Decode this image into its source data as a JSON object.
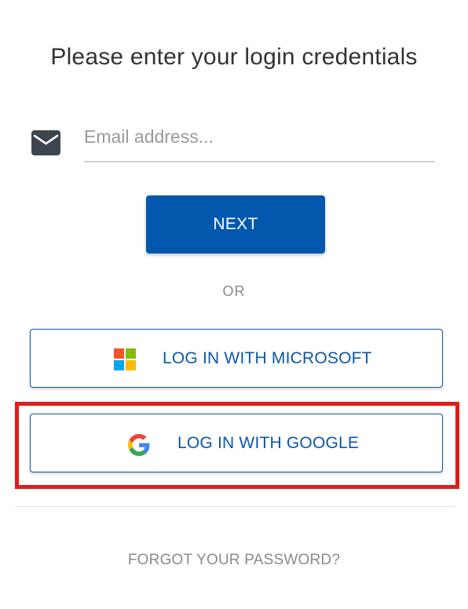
{
  "header": {
    "title": "Please enter your login credentials"
  },
  "email": {
    "value": "",
    "placeholder": "Email address...",
    "icon": "mail-icon"
  },
  "actions": {
    "next_label": "NEXT",
    "separator_label": "OR"
  },
  "sso": {
    "microsoft": {
      "label": "LOG IN WITH MICROSOFT",
      "icon": "microsoft-logo-icon"
    },
    "google": {
      "label": "LOG IN WITH GOOGLE",
      "icon": "google-logo-icon"
    }
  },
  "footer": {
    "forgot_label": "FORGOT YOUR PASSWORD?"
  },
  "colors": {
    "primary": "#0357ad",
    "link": "#0b57a8",
    "highlight": "#e01b1b",
    "muted": "#8a8a8a"
  }
}
